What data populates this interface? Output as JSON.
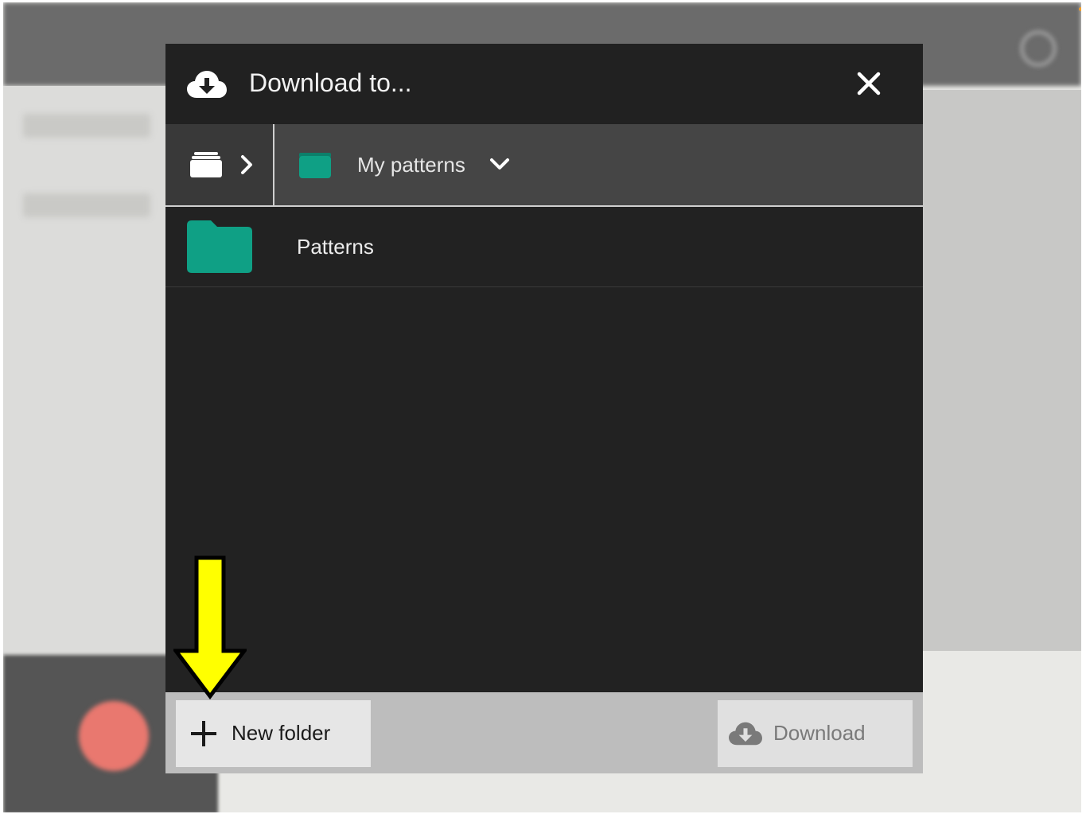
{
  "dialog": {
    "title": "Download to...",
    "header_icon": "cloud-download-icon",
    "close_icon": "close-icon"
  },
  "breadcrumb": {
    "root_icon": "folder-stack-icon",
    "separator_icon": "chevron-right-icon",
    "current": {
      "label": "My patterns",
      "icon": "folder-icon",
      "dropdown_icon": "chevron-down-icon"
    }
  },
  "files": [
    {
      "name": "Patterns",
      "icon": "folder-icon"
    }
  ],
  "footer": {
    "new_folder_label": "New folder",
    "new_folder_icon": "plus-icon",
    "download_label": "Download",
    "download_icon": "cloud-download-icon"
  },
  "annotation": {
    "arrow_icon": "arrow-down-icon",
    "arrow_color": "#ffff00"
  },
  "colors": {
    "folder_accent": "#0fa085",
    "dialog_bg": "#222222",
    "breadcrumb_bg": "#454545",
    "footer_bg": "#bdbdbd"
  }
}
